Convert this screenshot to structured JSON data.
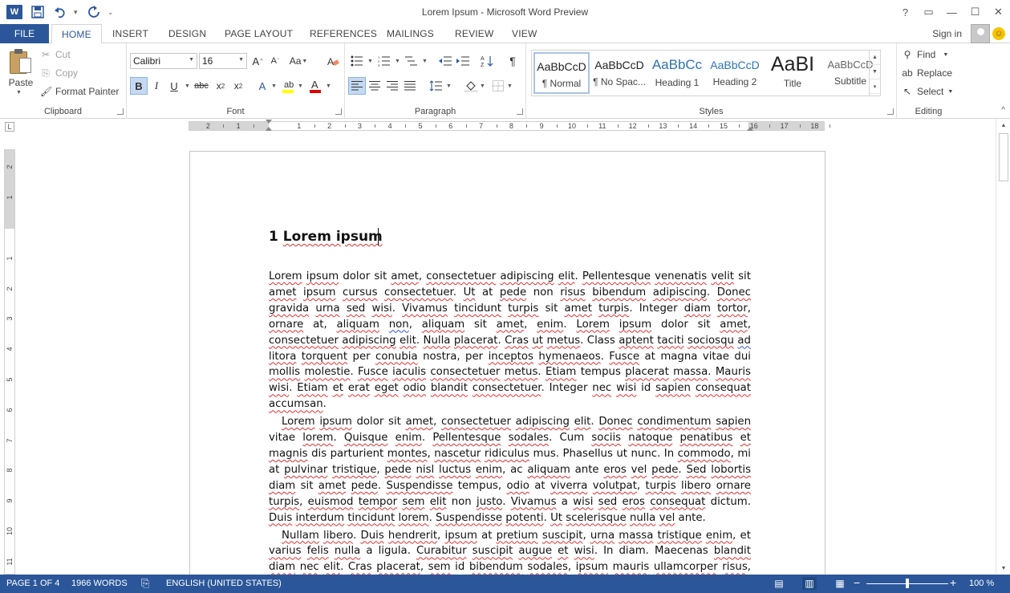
{
  "app": {
    "title": "Lorem Ipsum - Microsoft Word Preview",
    "icon_letter": "W",
    "window_controls": {
      "help": "?",
      "restore_ribbon": "▭",
      "minimize": "—",
      "maximize": "☐",
      "close": "✕"
    }
  },
  "tabs": {
    "file": "FILE",
    "items": [
      "HOME",
      "INSERT",
      "DESIGN",
      "PAGE LAYOUT",
      "REFERENCES",
      "MAILINGS",
      "REVIEW",
      "VIEW"
    ],
    "active": "HOME",
    "signin": "Sign in"
  },
  "clipboard": {
    "group_label": "Clipboard",
    "paste": "Paste",
    "cut": "Cut",
    "copy": "Copy",
    "format_painter": "Format Painter"
  },
  "font": {
    "group_label": "Font",
    "font_name": "Calibri",
    "font_size": "16"
  },
  "paragraph": {
    "group_label": "Paragraph"
  },
  "styles": {
    "group_label": "Styles",
    "items": [
      {
        "sample": "AaBbCcD",
        "name": "¶ Normal"
      },
      {
        "sample": "AaBbCcD",
        "name": "¶ No Spac..."
      },
      {
        "sample": "AaBbCc",
        "name": "Heading 1"
      },
      {
        "sample": "AaBbCcD",
        "name": "Heading 2"
      },
      {
        "sample": "AaBI",
        "name": "Title"
      },
      {
        "sample": "AaBbCcD",
        "name": "Subtitle"
      }
    ]
  },
  "editing": {
    "group_label": "Editing",
    "find": "Find",
    "replace": "Replace",
    "select": "Select"
  },
  "ruler": {
    "numbers": [
      "2",
      "1",
      "1",
      "2",
      "3",
      "4",
      "5",
      "6",
      "7",
      "8",
      "9",
      "10",
      "11",
      "12",
      "13",
      "14",
      "15",
      "16",
      "17",
      "18"
    ],
    "vnumbers": [
      "2",
      "1",
      "1",
      "2",
      "3",
      "4",
      "5",
      "6",
      "7",
      "8",
      "9",
      "10",
      "11"
    ],
    "corner": "L"
  },
  "document": {
    "heading_num": "1",
    "heading_text": "Lorem ipsum"
  },
  "status": {
    "page": "PAGE 1 OF 4",
    "words": "1966 WORDS",
    "language": "ENGLISH (UNITED STATES)",
    "zoom": "100 %",
    "zoom_level": 1.0
  }
}
